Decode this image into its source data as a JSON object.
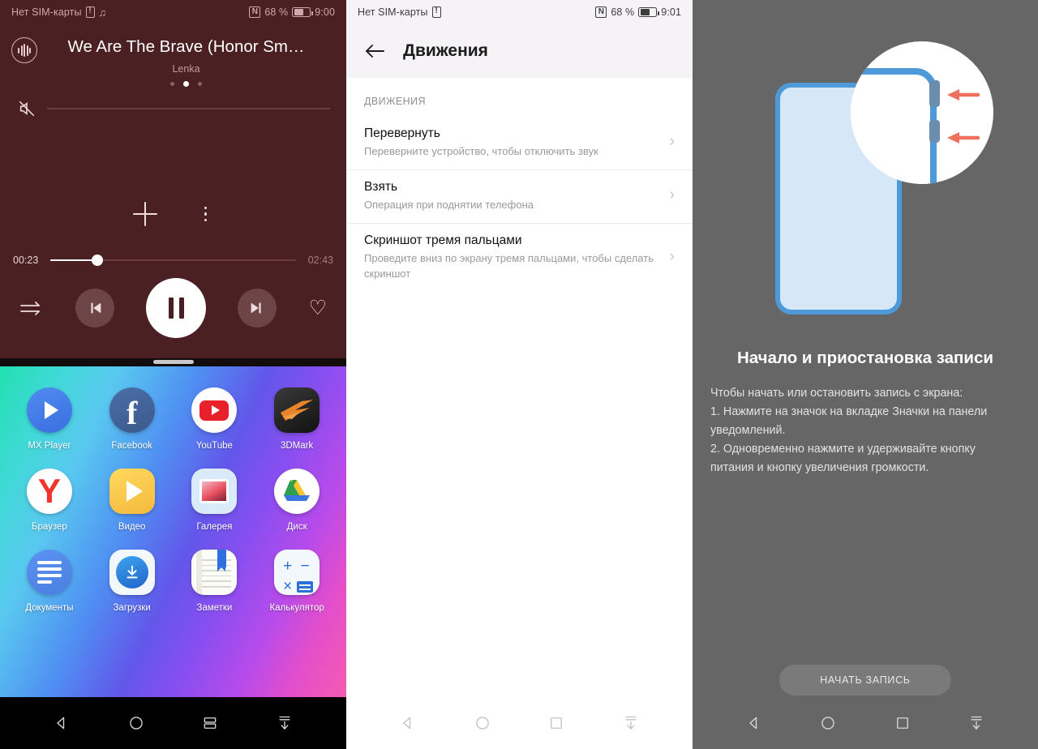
{
  "left_screen": {
    "status": {
      "carrier": "Нет SIM-карты",
      "sim_icon": "sim-card-icon",
      "music_icon": "music-note-icon",
      "nfc_icon": "nfc-icon",
      "battery_percent": "68 %",
      "battery_icon": "battery-icon",
      "time": "9:00"
    },
    "player": {
      "badge_icon": "sound-wave-icon",
      "title": "We Are The Brave (Honor Sm…",
      "artist": "Lenka",
      "page_dots": 3,
      "active_dot": 1,
      "mute_icon": "volume-muted-icon",
      "add_icon": "plus-icon",
      "more_icon": "more-vertical-icon",
      "elapsed": "00:23",
      "duration": "02:43",
      "progress_percent": 19,
      "repeat_icon": "repeat-sequence-icon",
      "previous_icon": "skip-previous-icon",
      "pause_icon": "pause-icon",
      "next_icon": "skip-next-icon",
      "favorite_icon": "heart-outline-icon"
    },
    "drawer": {
      "handle_icon": "drag-handle-icon",
      "apps": [
        {
          "label": "MX Player",
          "icon": "mx-player-icon"
        },
        {
          "label": "Facebook",
          "icon": "facebook-icon"
        },
        {
          "label": "YouTube",
          "icon": "youtube-icon"
        },
        {
          "label": "3DMark",
          "icon": "3dmark-icon"
        },
        {
          "label": "Браузер",
          "icon": "yandex-browser-icon"
        },
        {
          "label": "Видео",
          "icon": "video-player-icon"
        },
        {
          "label": "Галерея",
          "icon": "gallery-icon"
        },
        {
          "label": "Диск",
          "icon": "google-drive-icon"
        },
        {
          "label": "Документы",
          "icon": "google-docs-icon"
        },
        {
          "label": "Загрузки",
          "icon": "downloads-icon"
        },
        {
          "label": "Заметки",
          "icon": "notes-icon"
        },
        {
          "label": "Калькулятор",
          "icon": "calculator-icon"
        }
      ]
    },
    "nav": {
      "back_icon": "back-triangle-icon",
      "home_icon": "home-circle-icon",
      "recents_icon": "split-screen-icon",
      "hide_icon": "hide-navbar-icon"
    }
  },
  "mid_screen": {
    "status": {
      "carrier": "Нет SIM-карты",
      "sim_icon": "sim-card-icon",
      "nfc_icon": "nfc-icon",
      "battery_percent": "68 %",
      "battery_icon": "battery-icon",
      "time": "9:01"
    },
    "header": {
      "back_icon": "back-arrow-icon",
      "title": "Движения"
    },
    "section_label": "ДВИЖЕНИЯ",
    "items": [
      {
        "title": "Перевернуть",
        "subtitle": "Переверните устройство, чтобы отключить звук",
        "chevron": "chevron-right-icon"
      },
      {
        "title": "Взять",
        "subtitle": "Операция при поднятии телефона",
        "chevron": "chevron-right-icon"
      },
      {
        "title": "Скриншот тремя пальцами",
        "subtitle": "Проведите вниз по экрану тремя пальцами, чтобы сделать скриншот",
        "chevron": "chevron-right-icon"
      }
    ],
    "nav": {
      "back_icon": "back-triangle-icon",
      "home_icon": "home-circle-icon",
      "recents_icon": "recents-square-icon",
      "hide_icon": "hide-navbar-icon"
    }
  },
  "right_screen": {
    "illustration": {
      "name": "phone-side-buttons-illustration",
      "phone_icon": "phone-outline-icon",
      "magnifier_icon": "magnifier-circle-icon",
      "arrow_icons": [
        "left-arrow-icon",
        "left-arrow-icon"
      ],
      "phone_color": "#4e9ad8",
      "phone_fill": "#d6e8f8",
      "arrow_color": "#f0705e"
    },
    "title": "Начало и приостановка записи",
    "body": "Чтобы начать или остановить запись с экрана:\n1. Нажмите на значок на вкладке Значки на панели уведомлений.\n2. Одновременно нажмите и удерживайте кнопку питания и кнопку увеличения громкости.",
    "start_button": "НАЧАТЬ ЗАПИСЬ",
    "nav": {
      "back_icon": "back-triangle-icon",
      "home_icon": "home-circle-icon",
      "recents_icon": "recents-square-icon",
      "hide_icon": "hide-navbar-icon"
    }
  },
  "colors": {
    "player_bg": "#4a2023",
    "player_accent": "#ffffff",
    "settings_header_bg": "#f5f3f6",
    "right_bg": "#666666",
    "illus_blue": "#4e9ad8",
    "illus_arrow": "#f0705e"
  }
}
